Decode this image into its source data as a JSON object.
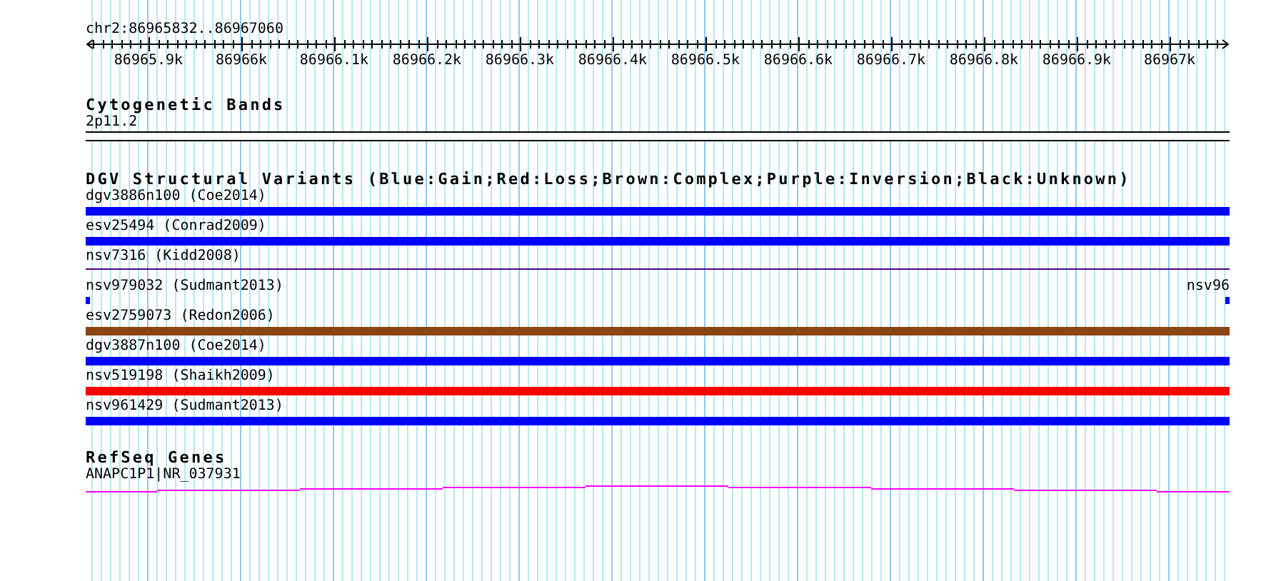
{
  "ruler": {
    "label": "chr2:86965832..86967060",
    "ticks": [
      "86965.9k",
      "86966k",
      "86966.1k",
      "86966.2k",
      "86966.3k",
      "86966.4k",
      "86966.5k",
      "86966.6k",
      "86966.7k",
      "86966.8k",
      "86966.9k",
      "86967k"
    ]
  },
  "cytogenetic_bands": {
    "title": "Cytogenetic Bands",
    "label": "2p11.2"
  },
  "structural_variants": {
    "title": "DGV Structural Variants (Blue:Gain;Red:Loss;Brown:Complex;Purple:Inversion;Black:Unknown)",
    "rows": [
      {
        "items": [
          {
            "label": "dgv3886n100 (Coe2014)",
            "color": "#0000ff",
            "kind": "bar"
          }
        ]
      },
      {
        "items": [
          {
            "label": "esv25494 (Conrad2009)",
            "color": "#0000ff",
            "kind": "bar"
          }
        ]
      },
      {
        "items": [
          {
            "label": "nsv7316 (Kidd2008)",
            "color": "#4b0082",
            "kind": "line"
          }
        ]
      },
      {
        "items": [
          {
            "label": "nsv979032 (Sudmant2013)",
            "color": "#0000ff",
            "kind": "stub"
          },
          {
            "label": "nsv96",
            "color": "#0000ff",
            "kind": "stub"
          }
        ]
      },
      {
        "items": [
          {
            "label": "esv2759073 (Redon2006)",
            "color": "#8b4513",
            "kind": "bar"
          }
        ]
      },
      {
        "items": [
          {
            "label": "dgv3887n100 (Coe2014)",
            "color": "#0000ff",
            "kind": "bar"
          }
        ]
      },
      {
        "items": [
          {
            "label": "nsv519198 (Shaikh2009)",
            "color": "#ff0000",
            "kind": "bar"
          }
        ]
      },
      {
        "items": [
          {
            "label": "nsv961429 (Sudmant2013)",
            "color": "#0000ff",
            "kind": "bar"
          }
        ]
      }
    ]
  },
  "refseq_genes": {
    "title": "RefSeq Genes",
    "label": "ANAPC1P1|NR_037931"
  }
}
